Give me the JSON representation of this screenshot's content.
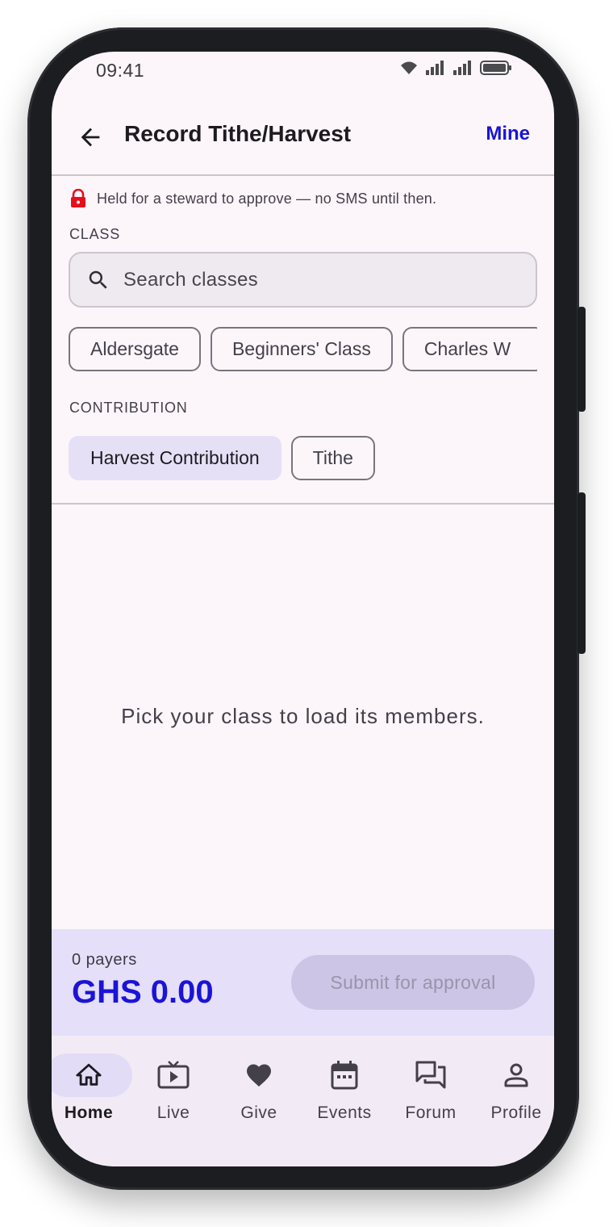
{
  "status": {
    "time": "09:41"
  },
  "appbar": {
    "title": "Record Tithe/Harvest",
    "action": "Mine"
  },
  "notice": {
    "text": "Held for a steward to approve — no SMS until then."
  },
  "class_section": {
    "label": "CLASS",
    "search_placeholder": "Search classes",
    "chips": [
      "Aldersgate",
      "Beginners' Class",
      "Charles W"
    ]
  },
  "contribution_section": {
    "label": "CONTRIBUTION",
    "options": [
      "Harvest Contribution",
      "Tithe"
    ],
    "selected": "Harvest Contribution"
  },
  "empty_state": {
    "message": "Pick your class to load its members."
  },
  "summary": {
    "payers": "0 payers",
    "total": "GHS 0.00",
    "submit": "Submit for approval"
  },
  "nav": {
    "items": [
      {
        "label": "Home",
        "icon": "home-icon",
        "active": true
      },
      {
        "label": "Live",
        "icon": "tv-icon",
        "active": false
      },
      {
        "label": "Give",
        "icon": "heart-icon",
        "active": false
      },
      {
        "label": "Events",
        "icon": "calendar-icon",
        "active": false
      },
      {
        "label": "Forum",
        "icon": "forum-icon",
        "active": false
      },
      {
        "label": "Profile",
        "icon": "person-icon",
        "active": false
      }
    ]
  },
  "colors": {
    "accent": "#1a14d6",
    "lock": "#e3101c",
    "selected_chip": "#e6e0f7",
    "summary_bg": "#e5dffa"
  }
}
